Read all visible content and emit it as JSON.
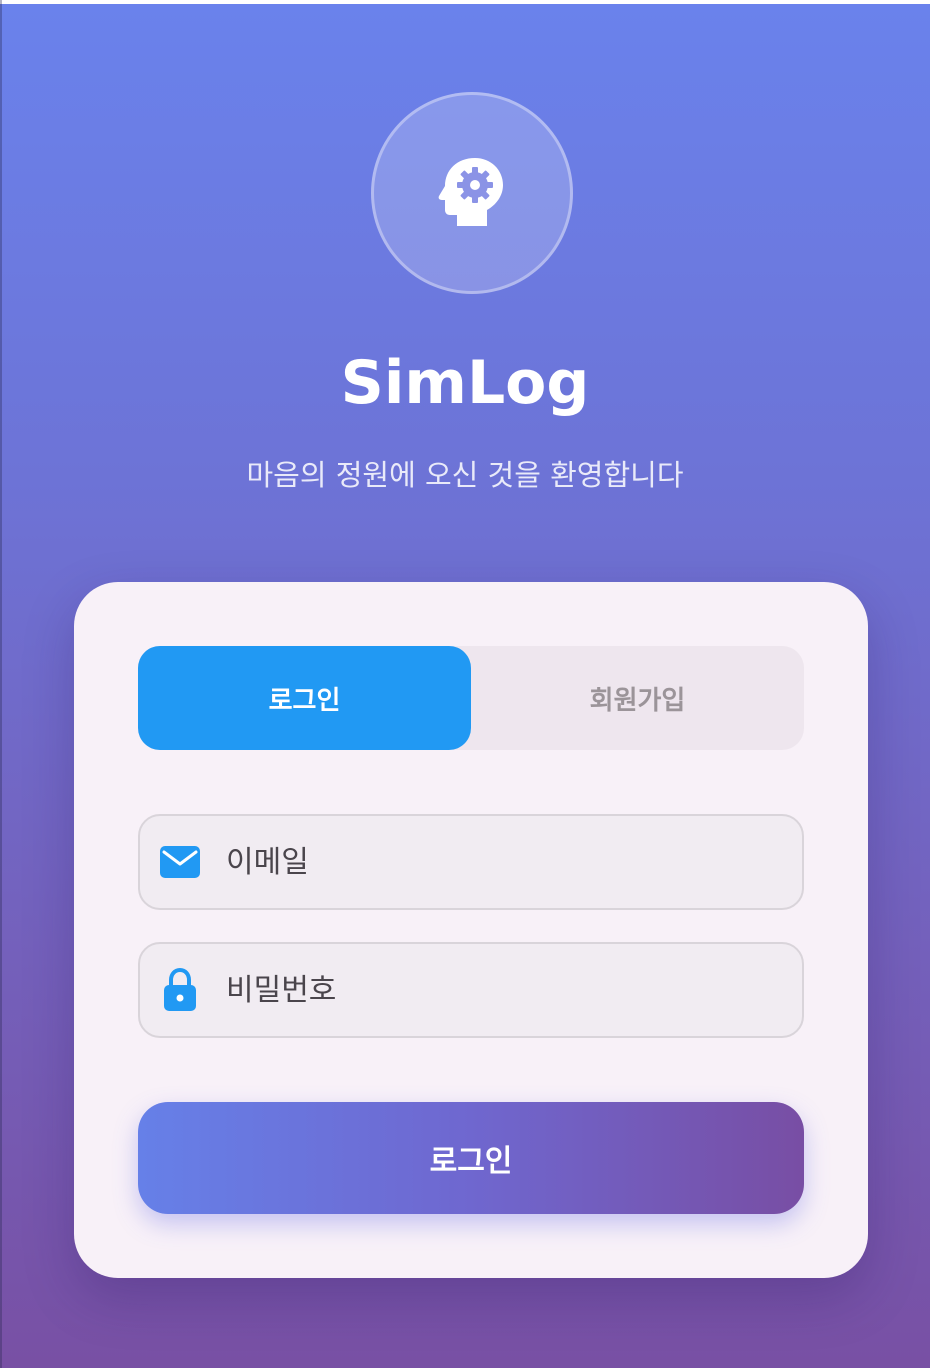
{
  "app": {
    "title": "SimLog",
    "subtitle": "마음의 정원에 오신 것을 환영합니다",
    "logo_icon": "head-gear-icon"
  },
  "tabs": [
    {
      "label": "로그인",
      "active": true
    },
    {
      "label": "회원가입",
      "active": false
    }
  ],
  "form": {
    "email": {
      "placeholder": "이메일",
      "value": "",
      "icon": "mail-icon"
    },
    "password": {
      "placeholder": "비밀번호",
      "value": "",
      "icon": "lock-icon"
    },
    "submit_label": "로그인"
  },
  "colors": {
    "accent": "#2199f3",
    "gradient_start": "#6a82ec",
    "gradient_end": "#7850a4",
    "card_bg": "#f8f1f8"
  }
}
